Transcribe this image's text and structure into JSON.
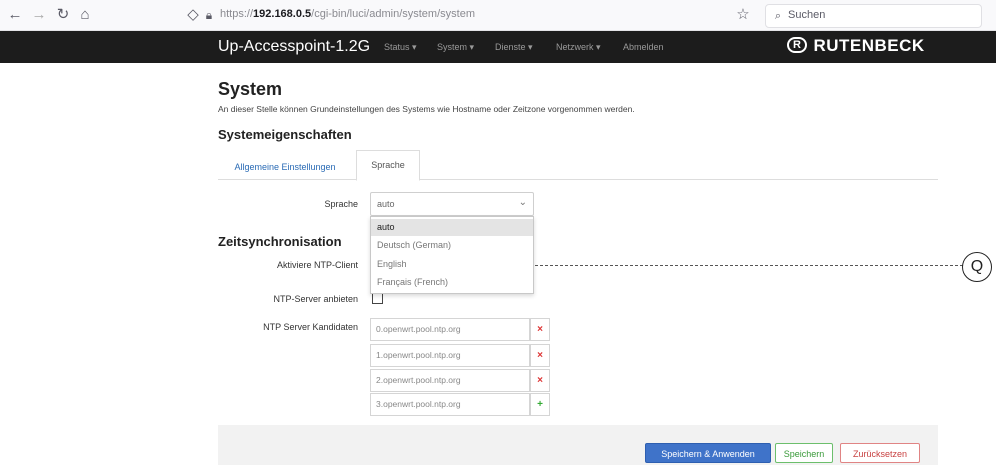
{
  "browser": {
    "url_prefix": "https://",
    "url_host": "192.168.0.5",
    "url_path": "/cgi-bin/luci/admin/system/system",
    "search_placeholder": "Suchen"
  },
  "header": {
    "brand": "Up-Accesspoint-1.2G",
    "menu": [
      "Status ▾",
      "System ▾",
      "Dienste ▾",
      "Netzwerk ▾",
      "Abmelden"
    ],
    "logo_mark": "R",
    "logo_text": "RUTENBECK"
  },
  "page": {
    "title": "System",
    "description": "An dieser Stelle können Grundeinstellungen des Systems wie Hostname oder Zeitzone vorgenommen werden.",
    "section_title": "Systemeigenschaften",
    "tabs": [
      "Allgemeine Einstellungen",
      "Sprache"
    ],
    "active_tab": "Sprache"
  },
  "sprache": {
    "label": "Sprache",
    "value": "auto",
    "options": [
      "auto",
      "Deutsch (German)",
      "English",
      "Français (French)"
    ],
    "selected_option": "auto"
  },
  "zeit": {
    "title": "Zeitsynchronisation",
    "ntp_client_label": "Aktiviere NTP-Client",
    "ntp_server_label": "NTP-Server anbieten",
    "ntp_server_checked": false,
    "candidates_label": "NTP Server Kandidaten",
    "candidates": [
      "0.openwrt.pool.ntp.org",
      "1.openwrt.pool.ntp.org",
      "2.openwrt.pool.ntp.org",
      "3.openwrt.pool.ntp.org"
    ],
    "remove_symbol": "×",
    "add_symbol": "+"
  },
  "callout": {
    "label": "Q"
  },
  "footer": {
    "apply": "Speichern & Anwenden",
    "save": "Speichern",
    "reset": "Zurücksetzen"
  },
  "colors": {
    "header_bg": "#1c1c1c",
    "link_blue": "#2a6bb5",
    "apply_blue": "#3f73c9",
    "save_green": "#3a9a3a",
    "reset_red": "#c84242"
  }
}
